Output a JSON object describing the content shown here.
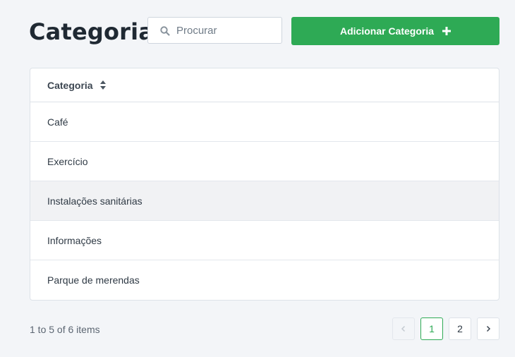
{
  "page": {
    "title": "Categorias"
  },
  "search": {
    "placeholder": "Procurar",
    "value": ""
  },
  "actions": {
    "add_label": "Adicionar Categoria"
  },
  "table": {
    "column_header": "Categoria",
    "rows": [
      "Café",
      "Exercício",
      "Instalações sanitárias",
      "Informações",
      "Parque de merendas"
    ]
  },
  "footer": {
    "summary": "1 to 5 of 6 items"
  },
  "pagination": {
    "pages": [
      "1",
      "2"
    ],
    "current": "1"
  },
  "colors": {
    "accent": "#2eaa55",
    "background": "#f3f5f8"
  },
  "icons": {
    "search": "search-icon",
    "add": "plus-icon",
    "sort": "sort-icon",
    "prev": "chevron-left-icon",
    "next": "chevron-right-icon"
  }
}
